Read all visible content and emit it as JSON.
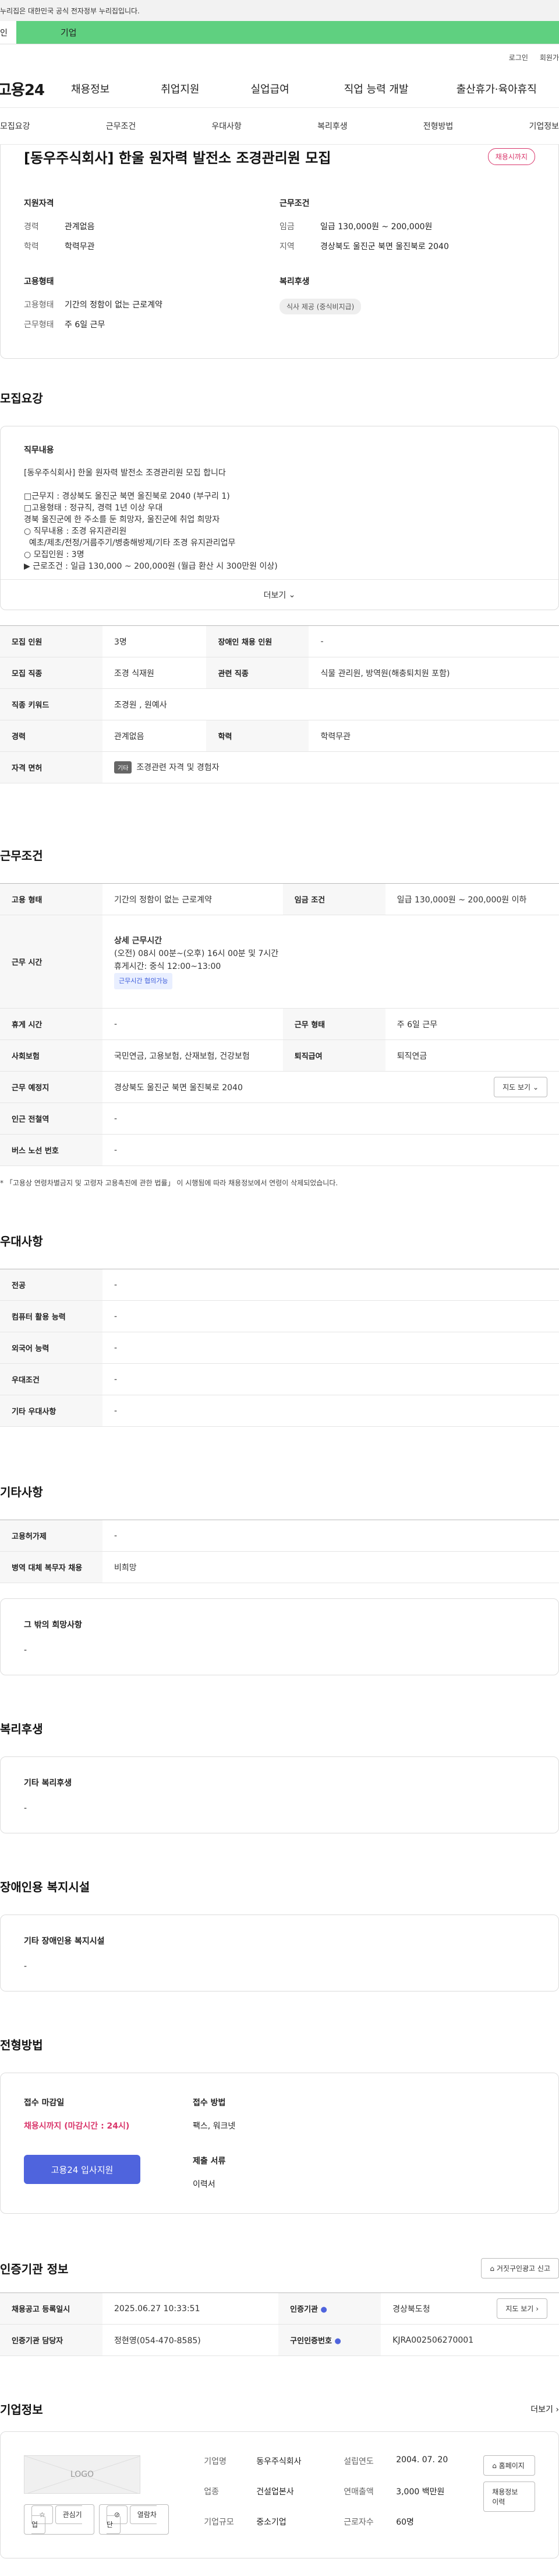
{
  "gov_bar": {
    "text": "누리집은 대한민국 공식 전자정부 누리집입니다."
  },
  "audience_tabs": {
    "person": "인",
    "company": "기업"
  },
  "util_links": {
    "login": "로그인",
    "join": "회원가"
  },
  "gnb": {
    "logo": "고용24",
    "menu": [
      "채용정보",
      "취업지원",
      "실업급여",
      "직업 능력 개발",
      "출산휴가·육아휴직"
    ]
  },
  "anchor_tabs": [
    "모집요강",
    "근무조건",
    "우대사항",
    "복리후생",
    "전형방법",
    "기업정보"
  ],
  "summary": {
    "title": "[동우주식회사] 한울 원자력 발전소 조경관리원 모집",
    "badge": "채용시까지",
    "qualification": {
      "label": "지원자격",
      "career_k": "경력",
      "career_v": "관계없음",
      "edu_k": "학력",
      "edu_v": "학력무관"
    },
    "conditions": {
      "label": "근무조건",
      "wage_k": "임금",
      "wage_v": "일급 130,000원 ~ 200,000원",
      "region_k": "지역",
      "region_v": "경상북도 울진군 북면 울진북로 2040"
    },
    "employment": {
      "label": "고용형태",
      "type_k": "고용형태",
      "type_v": "기간의 정함이 없는 근로계약",
      "days_k": "근무형태",
      "days_v": "주 6일 근무"
    },
    "welfare": {
      "label": "복리후생",
      "pill": "식사 제공 (중식비지급)"
    }
  },
  "recruit": {
    "title": "모집요강",
    "job_desc_label": "직무내용",
    "lines": [
      "[동우주식회사] 한울 원자력 발전소 조경관리원 모집 합니다",
      "",
      "□근무지 : 경상북도 울진군 북면 울진북로 2040 (부구리 1)",
      "□고용형태 : 정규직, 경력 1년 이상 우대",
      "경북 울진군에 한 주소를 둔 희망자, 울진군에 취업 희망자",
      "○ 직무내용 : 조경 유지관리원",
      "  예초/제초/전정/거름주기/병충해방제/기타 조경 유지관리업무",
      "○ 모집인원 : 3명",
      "▶ 근로조건 : 일급 130,000 ~ 200,000원 (월급 환산 시 300만원 이상)"
    ],
    "more": "더보기",
    "table": {
      "count_k": "모집 인원",
      "count_v": "3명",
      "disabled_k": "장애인 채용 인원",
      "disabled_v": "-",
      "job_k": "모집 직종",
      "job_v": "조경 식재원",
      "related_k": "관련 직종",
      "related_v": "식물 관리원, 방역원(해충퇴치원 포함)",
      "keyword_k": "직종 키워드",
      "keyword_v": "조경원 , 원예사",
      "career_k": "경력",
      "career_v": "관계없음",
      "edu_k": "학력",
      "edu_v": "학력무관",
      "license_k": "자격 면허",
      "license_tag": "기타",
      "license_v": "조경관련 자격 및 경험자"
    }
  },
  "work": {
    "title": "근무조건",
    "emp_type_k": "고용 형태",
    "emp_type_v": "기간의 정함이 없는 근로계약",
    "wage_k": "임금 조건",
    "wage_v": "일급 130,000원 ~ 200,000원 이하",
    "hours_k": "근무 시간",
    "hours_title": "상세 근무시간",
    "hours_line1": "(오전) 08시 00분~(오후) 16시 00분 및 7시간",
    "hours_line2": "휴게시간: 중식 12:00~13:00",
    "hours_tag": "근무시간 협의가능",
    "rest_k": "휴게 시간",
    "rest_v": "-",
    "shift_k": "근무 형태",
    "shift_v": "주 6일 근무",
    "insurance_k": "사회보험",
    "insurance_v": "국민연금, 고용보험, 산재보험, 건강보험",
    "severance_k": "퇴직급여",
    "severance_v": "퇴직연금",
    "place_k": "근무 예정지",
    "place_v": "경상북도 울진군 북면 울진북로 2040",
    "map_btn": "지도 보기",
    "subway_k": "인근 전철역",
    "subway_v": "-",
    "bus_k": "버스 노선 번호",
    "bus_v": "-",
    "note": "* 「고용상 연령차별금지 및 고령자 고용촉진에 관한 법률」 이 시행됨에 따라 채용정보에서 연령이 삭제되었습니다."
  },
  "preference": {
    "title": "우대사항",
    "major_k": "전공",
    "major_v": "-",
    "computer_k": "컴퓨터 활용 능력",
    "computer_v": "-",
    "language_k": "외국어 능력",
    "language_v": "-",
    "pref_k": "우대조건",
    "pref_v": "-",
    "other_k": "기타 우대사항",
    "other_v": "-"
  },
  "etc": {
    "title": "기타사항",
    "promotion_k": "고용허가제",
    "promotion_v": "-",
    "military_k": "병역 대체 복무자 채용",
    "military_v": "비희망",
    "wish_label": "그 밖의 희망사항",
    "wish_v": "-"
  },
  "welfare": {
    "title": "복리후생",
    "label": "기타 복리후생",
    "value": "-"
  },
  "disability": {
    "title": "장애인용 복지시설",
    "label": "기타 장애인용 복지시설",
    "value": "-"
  },
  "process": {
    "title": "전형방법",
    "deadline_label": "접수 마감일",
    "deadline_value": "채용시까지 (마감시간 : 24시)",
    "apply_btn": "고용24 입사지원",
    "method_label": "접수 방법",
    "method_value": "팩스, 워크넷",
    "docs_label": "제출 서류",
    "docs_value": "이력서"
  },
  "agency": {
    "title": "인증기관 정보",
    "report_btn": "거짓구인광고 신고",
    "reg_k": "채용공고 등록일시",
    "reg_v": "2025.06.27 10:33:51",
    "org_k": "인증기관",
    "org_v": "경상북도청",
    "map_btn": "지도 보기",
    "manager_k": "인증기관 담당자",
    "manager_v": "정현영(054-470-8585)",
    "id_k": "구인인증번호",
    "id_v": "KJRA002506270001"
  },
  "company": {
    "title": "기업정보",
    "more": "더보기",
    "logo": "LOGO",
    "fav_btn": "관심기업",
    "block_btn": "열람차단",
    "name_k": "기업명",
    "name_v": "동우주식회사",
    "year_k": "설립연도",
    "year_v": "2004. 07. 20",
    "industry_k": "업종",
    "industry_v": "건설업본사",
    "sales_k": "연매출액",
    "sales_v": "3,000 백만원",
    "size_k": "기업규모",
    "size_v": "중소기업",
    "staff_k": "근로자수",
    "staff_v": "60명",
    "homepage_btn": "홈페이지",
    "history_btn": "채용정보 이력"
  }
}
